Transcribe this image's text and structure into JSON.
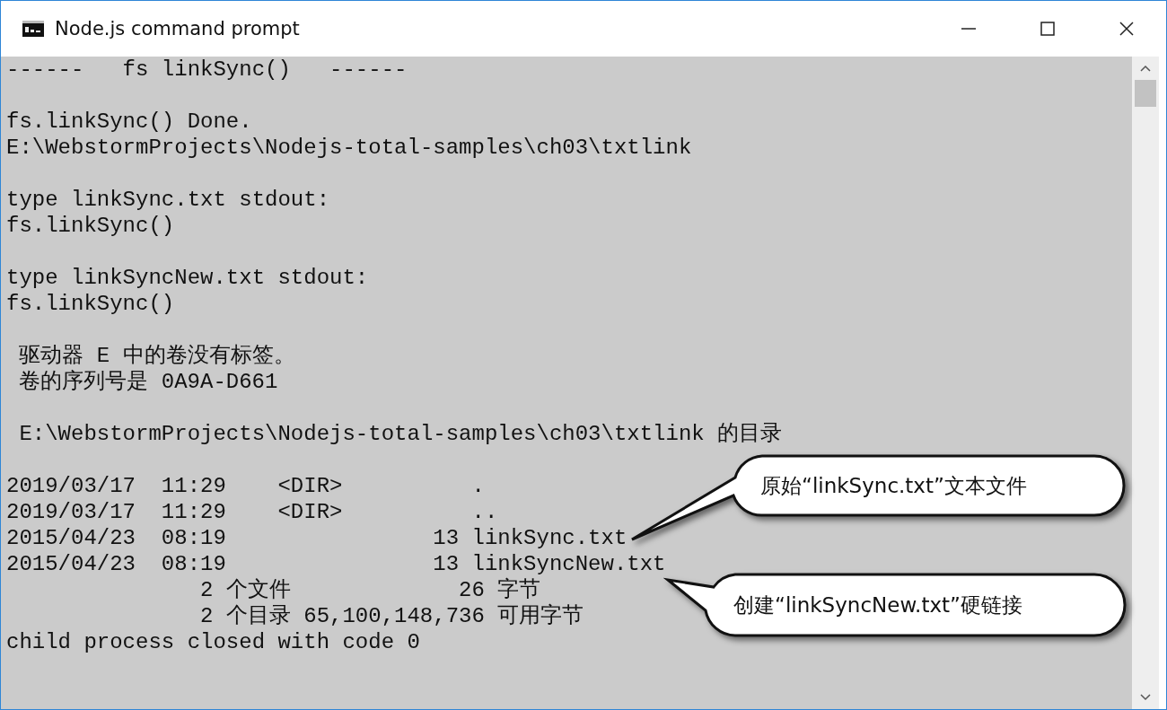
{
  "window": {
    "title": "Node.js command prompt"
  },
  "console": {
    "blocks": [
      [
        "------   fs linkSync()   ------"
      ],
      [
        "fs.linkSync() Done.",
        "E:\\WebstormProjects\\Nodejs-total-samples\\ch03\\txtlink"
      ],
      [
        "type linkSync.txt stdout:",
        "fs.linkSync()"
      ],
      [
        "type linkSyncNew.txt stdout:",
        "fs.linkSync()"
      ],
      [
        " 驱动器 E 中的卷没有标签。",
        " 卷的序列号是 0A9A-D661"
      ],
      [
        " E:\\WebstormProjects\\Nodejs-total-samples\\ch03\\txtlink 的目录"
      ],
      [
        "2019/03/17  11:29    <DIR>          .",
        "2019/03/17  11:29    <DIR>          ..",
        "2015/04/23  08:19                13 linkSync.txt",
        "2015/04/23  08:19                13 linkSyncNew.txt",
        "               2 个文件             26 字节",
        "               2 个目录 65,100,148,736 可用字节",
        "child process closed with code 0"
      ]
    ]
  },
  "callouts": [
    {
      "text": "原始“linkSync.txt”文本文件"
    },
    {
      "text": "创建“linkSyncNew.txt”硬链接"
    }
  ]
}
